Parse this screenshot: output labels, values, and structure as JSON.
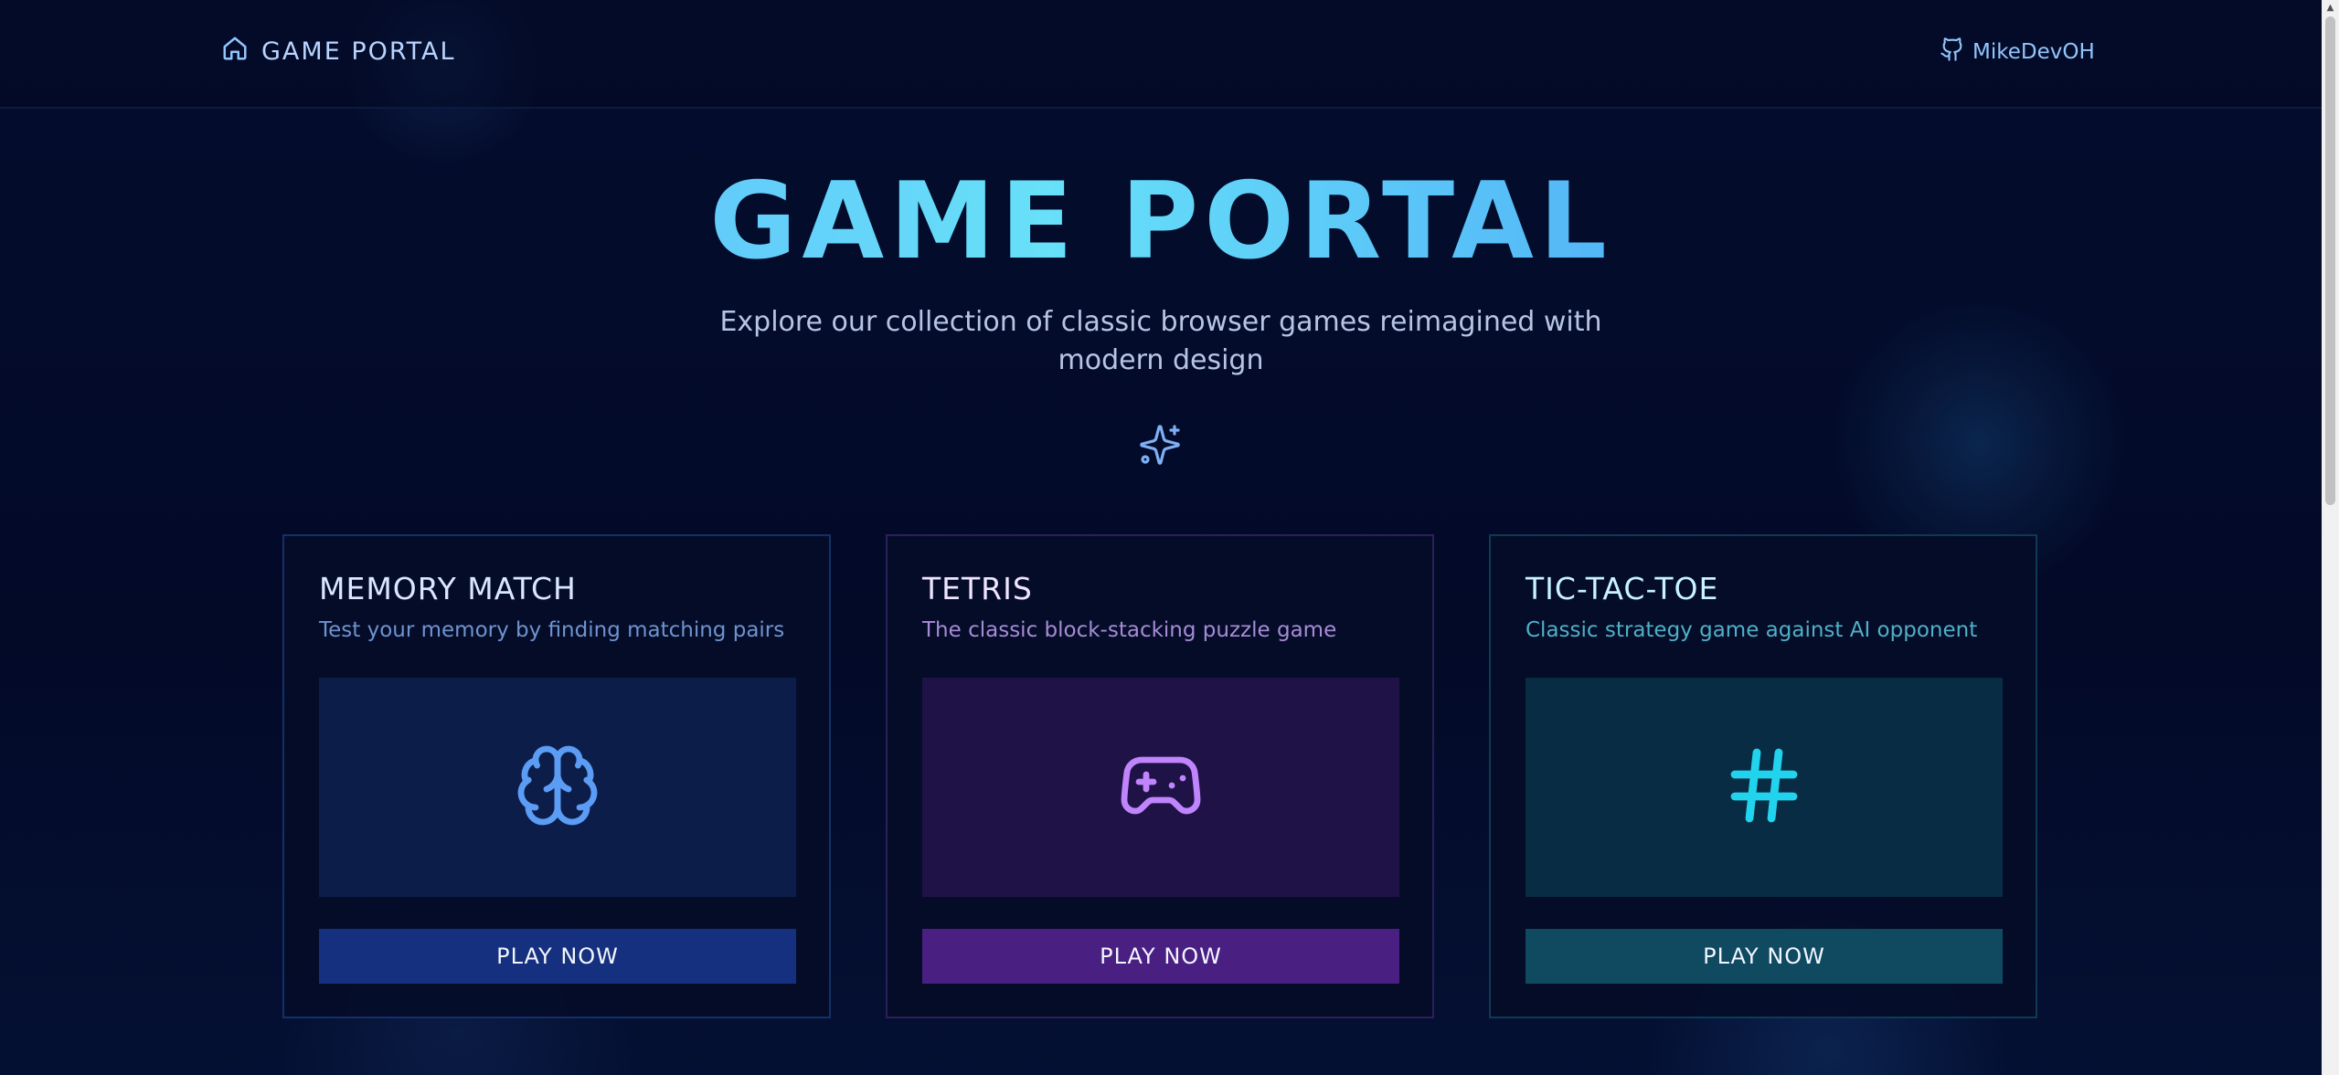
{
  "navbar": {
    "brand_label": "GAME PORTAL",
    "brand_icon": "home-icon",
    "github_label": "MikeDevOH",
    "github_icon": "github-icon"
  },
  "hero": {
    "title": "GAME PORTAL",
    "subtitle": "Explore our collection of classic browser games reimagined with modern design",
    "decoration_icon": "sparkles-icon"
  },
  "games": [
    {
      "title": "MEMORY MATCH",
      "description": "Test your memory by finding matching pairs",
      "icon": "brain-icon",
      "button_label": "PLAY NOW",
      "accent": "#5b9cf5"
    },
    {
      "title": "TETRIS",
      "description": "The classic block-stacking puzzle game",
      "icon": "gamepad-icon",
      "button_label": "PLAY NOW",
      "accent": "#c084fc"
    },
    {
      "title": "TIC-TAC-TOE",
      "description": "Classic strategy game against AI opponent",
      "icon": "hash-icon",
      "button_label": "PLAY NOW",
      "accent": "#22d3ee"
    }
  ]
}
